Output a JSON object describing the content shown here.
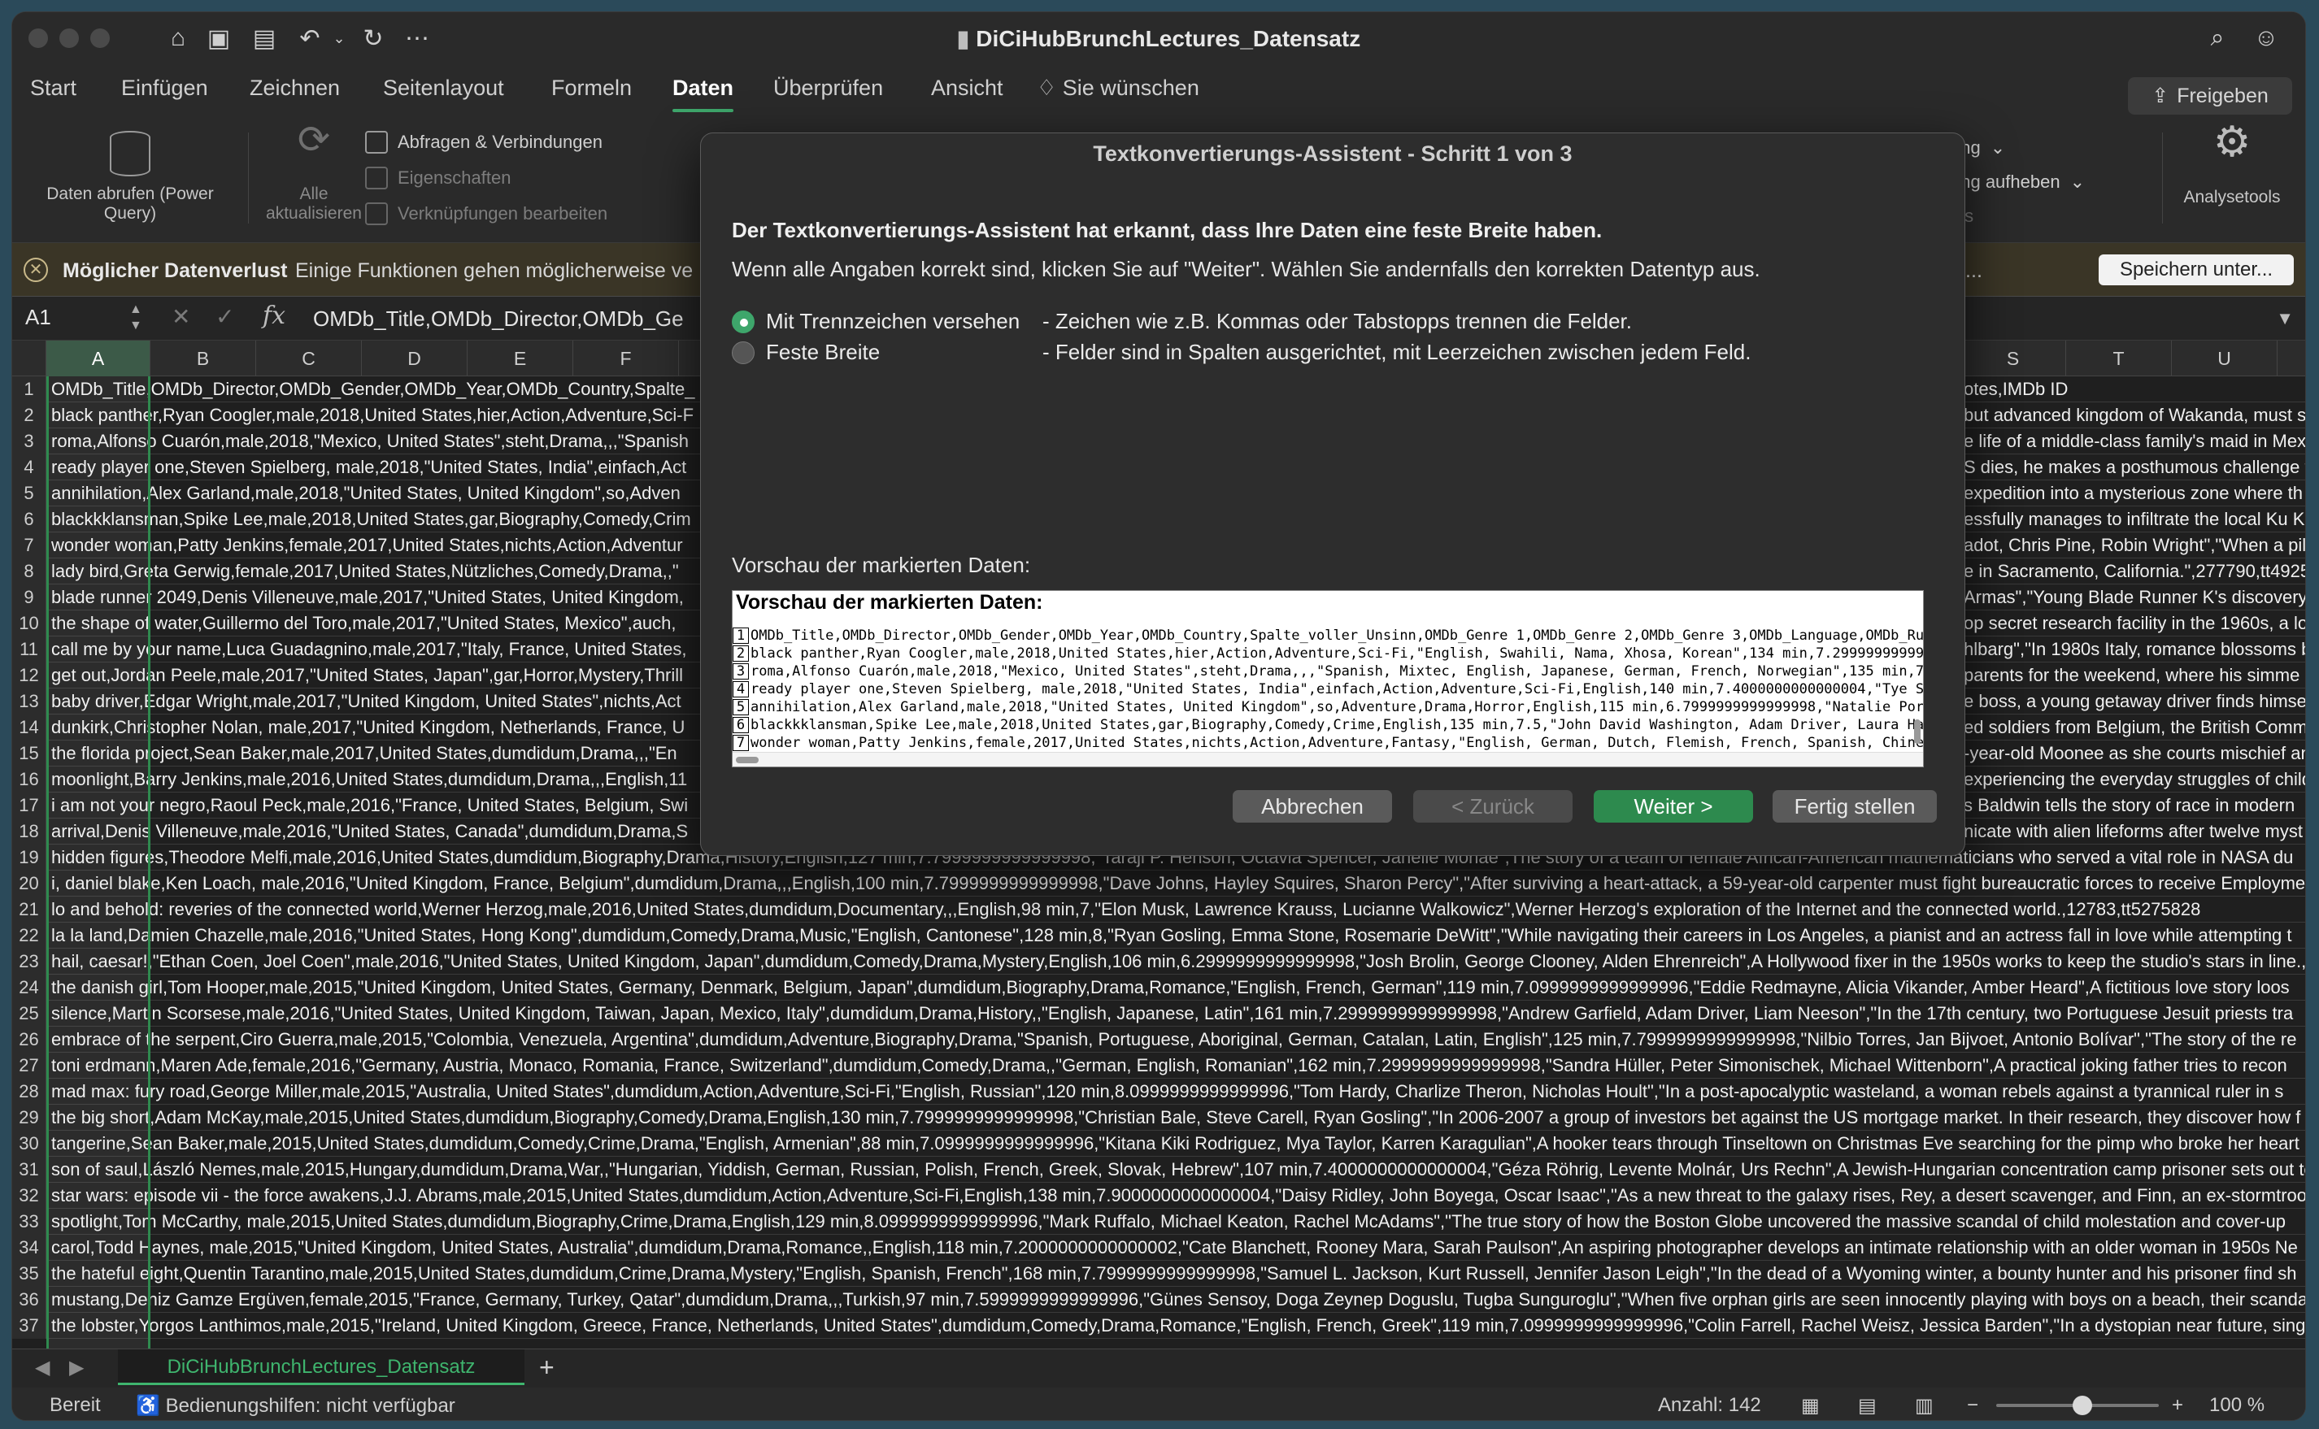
{
  "window": {
    "title": "DiCiHubBrunchLectures_Datensatz"
  },
  "menu": {
    "tabs": [
      "Start",
      "Einfügen",
      "Zeichnen",
      "Seitenlayout",
      "Formeln",
      "Daten",
      "Überprüfen",
      "Ansicht"
    ],
    "active": "Daten",
    "tell_me": "Sie wünschen",
    "share": "Freigeben"
  },
  "ribbon": {
    "get_data": "Daten abrufen (Power Query)",
    "refresh_all": "Alle aktualisieren",
    "queries": "Abfragen & Verbindungen",
    "properties": "Eigenschaften",
    "edit_links": "Verknüpfungen bearbeiten",
    "right_item1": "ung",
    "right_item2": "ung aufheben",
    "right_item3": "nis",
    "analysis": "Analysetools"
  },
  "message_bar": {
    "title": "Möglicher Datenverlust",
    "text": "Einige Funktionen gehen möglicherweise ve",
    "right_fragment": "si...",
    "button": "Speichern unter..."
  },
  "formula_bar": {
    "cell": "A1",
    "fx": "fx",
    "value": "OMDb_Title,OMDb_Director,OMDb_Ge"
  },
  "columns": [
    "A",
    "B",
    "C",
    "D",
    "E",
    "F",
    "S",
    "T",
    "U"
  ],
  "rows": [
    {
      "n": "1",
      "left": "OMDb_Title,OMDb_Director,OMDb_Gender,OMDb_Year,OMDb_Country,Spalte_",
      "right": "otes,IMDb ID"
    },
    {
      "n": "2",
      "left": "black panther,Ryan Coogler,male,2018,United States,hier,Action,Adventure,Sci-F",
      "right": "but advanced kingdom of Wakanda, must st"
    },
    {
      "n": "3",
      "left": "roma,Alfonso Cuarón,male,2018,\"Mexico, United States\",steht,Drama,,,\"Spanish",
      "right": "e life of a middle-class family's maid in Mex"
    },
    {
      "n": "4",
      "left": "ready player one,Steven Spielberg, male,2018,\"United States, India\",einfach,Act",
      "right": "S dies, he makes a posthumous challenge to"
    },
    {
      "n": "5",
      "left": "annihilation,Alex Garland,male,2018,\"United States, United Kingdom\",so,Adven",
      "right": "expedition into a mysterious zone where th"
    },
    {
      "n": "6",
      "left": "blackkklansman,Spike Lee,male,2018,United States,gar,Biography,Comedy,Crim",
      "right": "essfully manages to infiltrate the local Ku K"
    },
    {
      "n": "7",
      "left": "wonder woman,Patty Jenkins,female,2017,United States,nichts,Action,Adventur",
      "right": "adot, Chris Pine, Robin Wright\",\"When a pilo"
    },
    {
      "n": "8",
      "left": "lady bird,Greta Gerwig,female,2017,United States,Nützliches,Comedy,Drama,,\"",
      "right": "e in Sacramento, California.\",277790,tt4925"
    },
    {
      "n": "9",
      "left": "blade runner 2049,Denis Villeneuve,male,2017,\"United States, United Kingdom,",
      "right": "Armas\",\"Young Blade Runner K's discovery o"
    },
    {
      "n": "10",
      "left": "the shape of water,Guillermo del Toro,male,2017,\"United States, Mexico\",auch,",
      "right": "op secret research facility in the 1960s, a lon"
    },
    {
      "n": "11",
      "left": "call me by your name,Luca Guadagnino,male,2017,\"Italy, France, United States,",
      "right": "hlbarg\",\"In 1980s Italy, romance blossoms b"
    },
    {
      "n": "12",
      "left": "get out,Jordan Peele,male,2017,\"United States, Japan\",gar,Horror,Mystery,Thrill",
      "right": "parents for the weekend, where his simme"
    },
    {
      "n": "13",
      "left": "baby driver,Edgar Wright,male,2017,\"United Kingdom, United States\",nichts,Act",
      "right": "e boss, a young getaway driver finds himsel"
    },
    {
      "n": "14",
      "left": "dunkirk,Christopher Nolan, male,2017,\"United Kingdom, Netherlands, France, U",
      "right": "ed soldiers from Belgium, the British Comm"
    },
    {
      "n": "15",
      "left": "the florida project,Sean Baker,male,2017,United States,dumdidum,Drama,,,\"En",
      "right": "-year-old Moonee as she courts mischief an"
    },
    {
      "n": "16",
      "left": "moonlight,Barry Jenkins,male,2016,United States,dumdidum,Drama,,,English,11",
      "right": "experiencing the everyday struggles of child"
    },
    {
      "n": "17",
      "left": "i am not your negro,Raoul Peck,male,2016,\"France, United States, Belgium, Swi",
      "right": "s Baldwin tells the story of race in modern"
    },
    {
      "n": "18",
      "left": "arrival,Denis Villeneuve,male,2016,\"United States, Canada\",dumdidum,Drama,S",
      "right": "nicate with alien lifeforms after twelve myst"
    },
    {
      "n": "19",
      "left": "hidden figures,Theodore Melfi,male,2016,United States,dumdidum,Biography,Drama,History,English,127 min,7.7999999999999998,\"Taraji P. Henson, Octavia Spencer, Janelle Monáe\",The story of a team of female African-American mathematicians who served a vital role in NASA du",
      "right": ""
    },
    {
      "n": "20",
      "left": "i, daniel blake,Ken Loach, male,2016,\"United Kingdom, France, Belgium\",dumdidum,Drama,,,English,100 min,7.7999999999999998,\"Dave Johns, Hayley Squires, Sharon Percy\",\"After surviving a heart-attack, a 59-year-old carpenter must fight bureaucratic forces to receive Employmen",
      "right": ""
    },
    {
      "n": "21",
      "left": "lo and behold: reveries of the connected world,Werner Herzog,male,2016,United States,dumdidum,Documentary,,,English,98 min,7,\"Elon Musk, Lawrence Krauss, Lucianne Walkowicz\",Werner Herzog's exploration of the Internet and the connected world.,12783,tt5275828",
      "right": ""
    },
    {
      "n": "22",
      "left": "la la land,Damien Chazelle,male,2016,\"United States, Hong Kong\",dumdidum,Comedy,Drama,Music,\"English, Cantonese\",128 min,8,\"Ryan Gosling, Emma Stone, Rosemarie DeWitt\",\"While navigating their careers in Los Angeles, a pianist and an actress fall in love while attempting t",
      "right": ""
    },
    {
      "n": "23",
      "left": "hail, caesar!,\"Ethan Coen, Joel Coen\",male,2016,\"United States, United Kingdom, Japan\",dumdidum,Comedy,Drama,Mystery,English,106 min,6.2999999999999998,\"Josh Brolin, George Clooney, Alden Ehrenreich\",A Hollywood fixer in the 1950s works to keep the studio's stars in line.,",
      "right": ""
    },
    {
      "n": "24",
      "left": "the danish girl,Tom Hooper,male,2015,\"United Kingdom, United States, Germany, Denmark, Belgium, Japan\",dumdidum,Biography,Drama,Romance,\"English, French, German\",119 min,7.0999999999999996,\"Eddie Redmayne, Alicia Vikander, Amber Heard\",A fictitious love story loos",
      "right": ""
    },
    {
      "n": "25",
      "left": "silence,Martin Scorsese,male,2016,\"United States, United Kingdom, Taiwan, Japan, Mexico, Italy\",dumdidum,Drama,History,,\"English, Japanese, Latin\",161 min,7.2999999999999998,\"Andrew Garfield, Adam Driver, Liam Neeson\",\"In the 17th century, two Portuguese Jesuit priests tra",
      "right": ""
    },
    {
      "n": "26",
      "left": "embrace of the serpent,Ciro Guerra,male,2015,\"Colombia, Venezuela, Argentina\",dumdidum,Adventure,Biography,Drama,\"Spanish, Portuguese, Aboriginal, German, Catalan, Latin, English\",125 min,7.7999999999999998,\"Nilbio Torres, Jan Bijvoet, Antonio Bolívar\",\"The story of the re",
      "right": ""
    },
    {
      "n": "27",
      "left": "toni erdmann,Maren Ade,female,2016,\"Germany, Austria, Monaco, Romania, France, Switzerland\",dumdidum,Comedy,Drama,,\"German, English, Romanian\",162 min,7.2999999999999998,\"Sandra Hüller, Peter Simonischek, Michael Wittenborn\",A practical joking father tries to recon",
      "right": ""
    },
    {
      "n": "28",
      "left": "mad max: fury road,George Miller,male,2015,\"Australia, United States\",dumdidum,Action,Adventure,Sci-Fi,\"English, Russian\",120 min,8.0999999999999996,\"Tom Hardy, Charlize Theron, Nicholas Hoult\",\"In a post-apocalyptic wasteland, a woman rebels against a tyrannical ruler in s",
      "right": ""
    },
    {
      "n": "29",
      "left": "the big short,Adam McKay,male,2015,United States,dumdidum,Biography,Comedy,Drama,English,130 min,7.7999999999999998,\"Christian Bale, Steve Carell, Ryan Gosling\",\"In 2006-2007 a group of investors bet against the US mortgage market. In their research, they discover how f",
      "right": ""
    },
    {
      "n": "30",
      "left": "tangerine,Sean Baker,male,2015,United States,dumdidum,Comedy,Crime,Drama,\"English, Armenian\",88 min,7.0999999999999996,\"Kitana Kiki Rodriguez, Mya Taylor, Karren Karagulian\",A hooker tears through Tinseltown on Christmas Eve searching for the pimp who broke her heart",
      "right": ""
    },
    {
      "n": "31",
      "left": "son of saul,László Nemes,male,2015,Hungary,dumdidum,Drama,War,,\"Hungarian, Yiddish, German, Russian, Polish, French, Greek, Slovak, Hebrew\",107 min,7.4000000000000004,\"Géza Röhrig, Levente Molnár, Urs Rechn\",A Jewish-Hungarian concentration camp prisoner sets out to",
      "right": ""
    },
    {
      "n": "32",
      "left": "star wars: episode vii - the force awakens,J.J. Abrams,male,2015,United States,dumdidum,Action,Adventure,Sci-Fi,English,138 min,7.9000000000000004,\"Daisy Ridley, John Boyega, Oscar Isaac\",\"As a new threat to the galaxy rises, Rey, a desert scavenger, and Finn, an ex-stormtroop",
      "right": ""
    },
    {
      "n": "33",
      "left": "spotlight,Tom McCarthy, male,2015,United States,dumdidum,Biography,Crime,Drama,English,129 min,8.0999999999999996,\"Mark Ruffalo, Michael Keaton, Rachel McAdams\",\"The true story of how the Boston Globe uncovered the massive scandal of child molestation and cover-up",
      "right": ""
    },
    {
      "n": "34",
      "left": "carol,Todd Haynes, male,2015,\"United Kingdom, United States, Australia\",dumdidum,Drama,Romance,,English,118 min,7.2000000000000002,\"Cate Blanchett, Rooney Mara, Sarah Paulson\",An aspiring photographer develops an intimate relationship with an older woman in 1950s Ne",
      "right": ""
    },
    {
      "n": "35",
      "left": "the hateful eight,Quentin Tarantino,male,2015,United States,dumdidum,Crime,Drama,Mystery,\"English, Spanish, French\",168 min,7.7999999999999998,\"Samuel L. Jackson, Kurt Russell, Jennifer Jason Leigh\",\"In the dead of a Wyoming winter, a bounty hunter and his prisoner find sh",
      "right": ""
    },
    {
      "n": "36",
      "left": "mustang,Deniz Gamze Ergüven,female,2015,\"France, Germany, Turkey, Qatar\",dumdidum,Drama,,,Turkish,97 min,7.5999999999999996,\"Günes Sensoy, Doga Zeynep Doguslu, Tugba Sunguroglu\",\"When five orphan girls are seen innocently playing with boys on a beach, their scandalo",
      "right": ""
    },
    {
      "n": "37",
      "left": "the lobster,Yorgos Lanthimos,male,2015,\"Ireland, United Kingdom, Greece, France, Netherlands, United States\",dumdidum,Comedy,Drama,Romance,\"English, French, Greek\",119 min,7.0999999999999996,\"Colin Farrell, Rachel Weisz, Jessica Barden\",\"In a dystopian near future, sing",
      "right": ""
    }
  ],
  "dialog": {
    "title": "Textkonvertierungs-Assistent - Schritt 1 von 3",
    "line1": "Der Textkonvertierungs-Assistent hat erkannt, dass Ihre Daten eine feste Breite haben.",
    "line2": "Wenn alle Angaben korrekt sind, klicken Sie auf \"Weiter\". Wählen Sie andernfalls den korrekten Datentyp aus.",
    "option1_label": "Mit Trennzeichen versehen",
    "option1_desc": "- Zeichen wie z.B. Kommas oder Tabstopps trennen die Felder.",
    "option2_label": "Feste Breite",
    "option2_desc": "- Felder sind in Spalten ausgerichtet, mit Leerzeichen zwischen jedem Feld.",
    "selected": "Mit Trennzeichen versehen",
    "preview_label": "Vorschau der markierten Daten:",
    "preview_title": "Vorschau der markierten Daten:",
    "preview_lines": [
      {
        "n": "1",
        "t": "OMDb_Title,OMDb_Director,OMDb_Gender,OMDb_Year,OMDb_Country,Spalte_voller_Unsinn,OMDb_Genre 1,OMDb_Genre 2,OMDb_Genre 3,OMDb_Language,OMDb_Runt"
      },
      {
        "n": "2",
        "t": "black panther,Ryan Coogler,male,2018,United States,hier,Action,Adventure,Sci-Fi,\"English, Swahili, Nama, Xhosa, Korean\",134 min,7.2999999999999"
      },
      {
        "n": "3",
        "t": "roma,Alfonso Cuarón,male,2018,\"Mexico, United States\",steht,Drama,,,\"Spanish, Mixtec, English, Japanese, German, French, Norwegian\",135 min,7.7"
      },
      {
        "n": "4",
        "t": "ready player one,Steven Spielberg, male,2018,\"United States, India\",einfach,Action,Adventure,Sci-Fi,English,140 min,7.4000000000000004,\"Tye She"
      },
      {
        "n": "5",
        "t": "annihilation,Alex Garland,male,2018,\"United States, United Kingdom\",so,Adventure,Drama,Horror,English,115 min,6.7999999999999998,\"Natalie Portm"
      },
      {
        "n": "6",
        "t": "blackkklansman,Spike Lee,male,2018,United States,gar,Biography,Comedy,Crime,English,135 min,7.5,\"John David Washington, Adam Driver, Laura Harr"
      },
      {
        "n": "7",
        "t": "wonder woman,Patty Jenkins,female,2017,United States,nichts,Action,Adventure,Fantasy,\"English, German, Dutch, Flemish, French, Spanish, Chinese"
      }
    ],
    "buttons": {
      "cancel": "Abbrechen",
      "back": "< Zurück",
      "next": "Weiter >",
      "finish": "Fertig stellen"
    }
  },
  "sheet": {
    "tab": "DiCiHubBrunchLectures_Datensatz",
    "add": "+"
  },
  "status": {
    "ready": "Bereit",
    "accessibility": "Bedienungshilfen: nicht verfügbar",
    "count": "Anzahl: 142",
    "zoom": "100 %"
  }
}
